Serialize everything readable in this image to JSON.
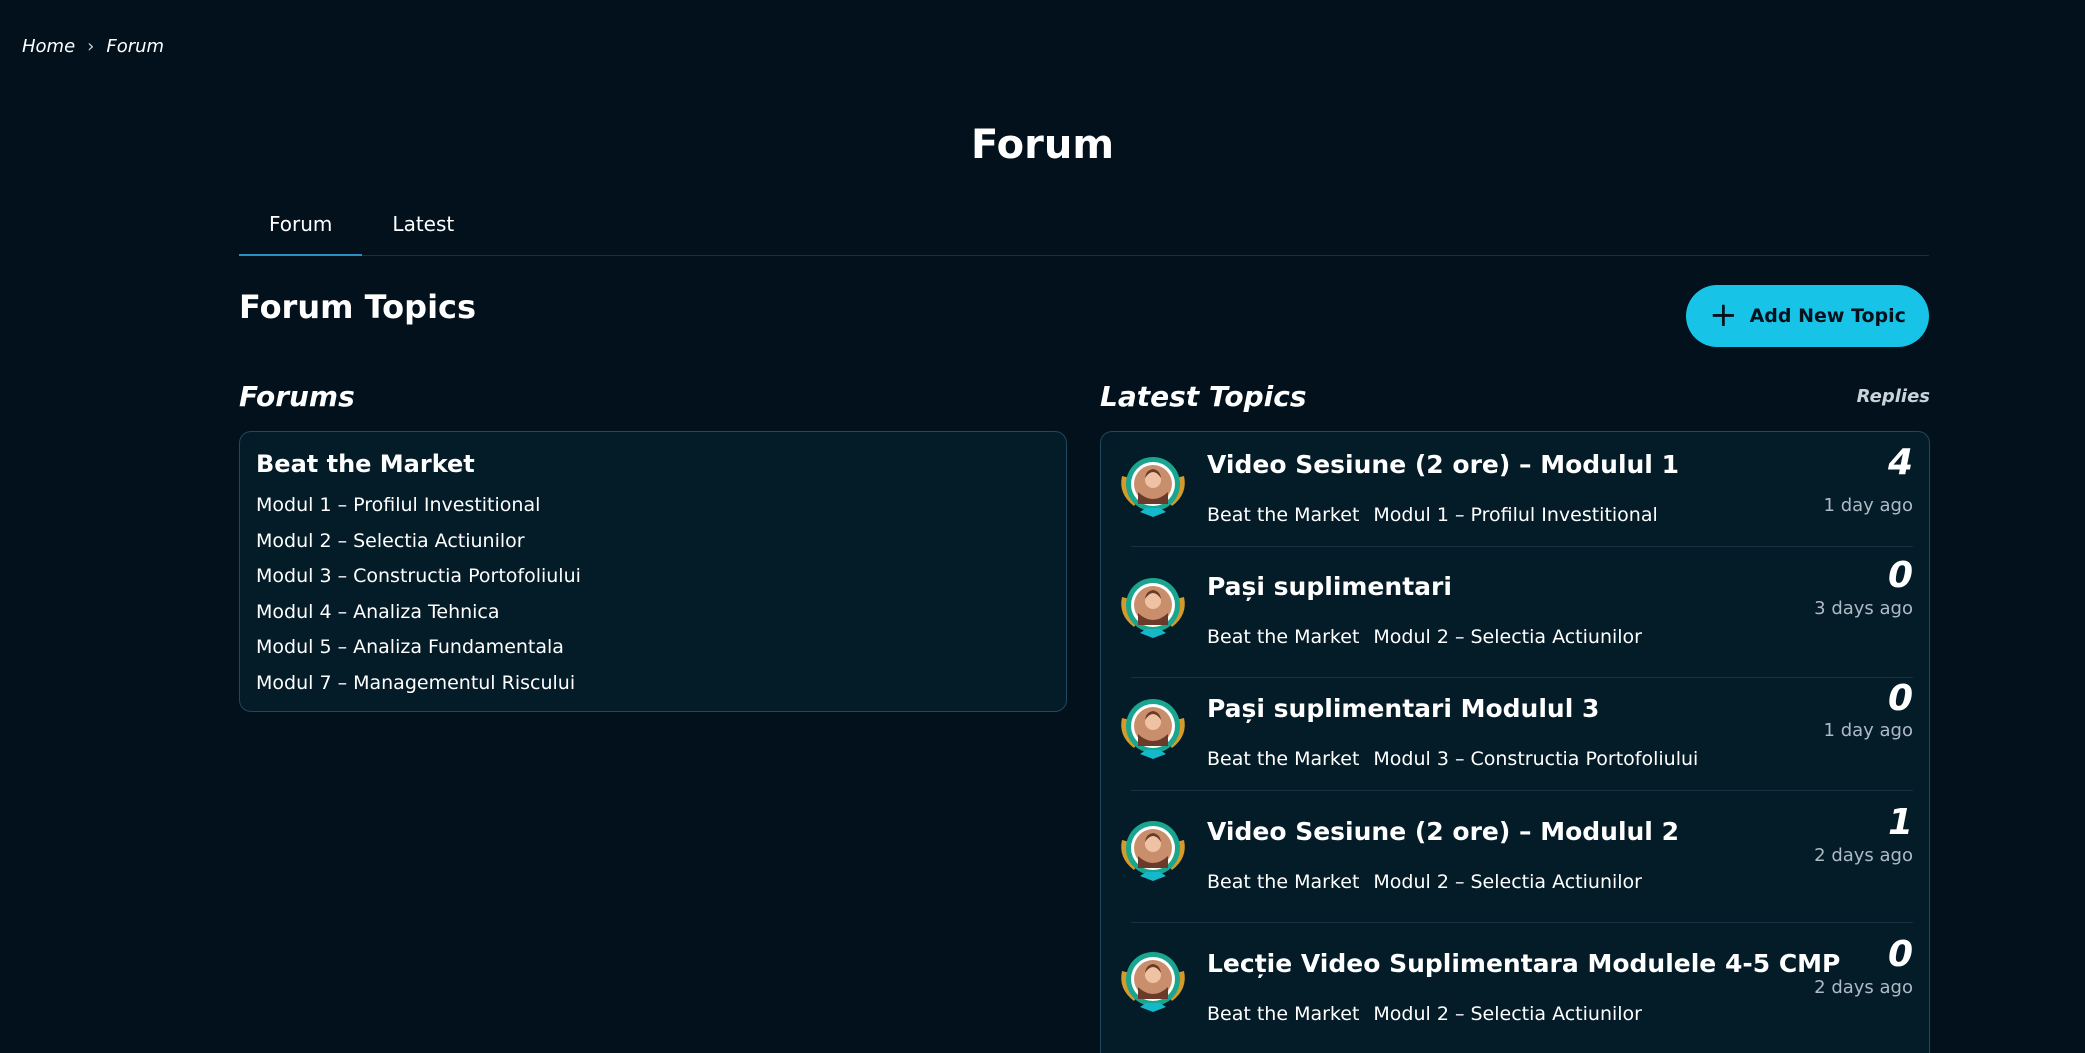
{
  "breadcrumb": {
    "home": "Home",
    "current": "Forum"
  },
  "page": {
    "title": "Forum"
  },
  "tabs": [
    {
      "label": "Forum"
    },
    {
      "label": "Latest"
    }
  ],
  "section": {
    "title": "Forum Topics",
    "add_button": "Add New Topic"
  },
  "forums": {
    "label": "Forums",
    "groups": [
      {
        "name": "Beat the Market",
        "items": [
          "Modul 1 – Profilul Investitional",
          "Modul 2 – Selectia Actiunilor",
          "Modul 3 – Constructia Portofoliului",
          "Modul 4 – Analiza Tehnica",
          "Modul 5 – Analiza Fundamentala",
          "Modul 7 – Managementul Riscului"
        ]
      }
    ]
  },
  "latest": {
    "label": "Latest Topics",
    "replies_label": "Replies",
    "topics": [
      {
        "title": "Video Sesiune (2 ore) – Modulul 1",
        "forum": "Beat the Market",
        "module": "Modul 1 – Profilul Investitional",
        "replies": "4",
        "time": "1 day ago"
      },
      {
        "title": "Pași suplimentari",
        "forum": "Beat the Market",
        "module": "Modul 2 – Selectia Actiunilor",
        "replies": "0",
        "time": "3 days ago"
      },
      {
        "title": "Pași suplimentari Modulul 3",
        "forum": "Beat the Market",
        "module": "Modul 3 – Constructia Portofoliului",
        "replies": "0",
        "time": "1 day ago"
      },
      {
        "title": "Video Sesiune (2 ore) – Modulul 2",
        "forum": "Beat the Market",
        "module": "Modul 2 – Selectia Actiunilor",
        "replies": "1",
        "time": "2 days ago"
      },
      {
        "title": "Lecție Video Suplimentara Modulele 4-5 CMP",
        "forum": "Beat the Market",
        "module": "Modul 2 – Selectia Actiunilor",
        "replies": "0",
        "time": "2 days ago"
      }
    ]
  },
  "colors": {
    "background": "#02111b",
    "accent": "#17c4e8",
    "card": "#041b28",
    "border": "#1d4a5c"
  },
  "icons": {
    "breadcrumb_separator": "chevron-right-icon",
    "add": "plus-icon",
    "avatar": "avatar-badge-icon"
  }
}
